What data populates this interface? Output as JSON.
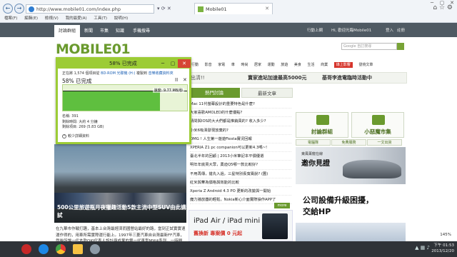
{
  "browser": {
    "url": "http://www.mobile01.com/index.php",
    "tab_title": "Mobile01",
    "back_glyph": "←",
    "forward_glyph": "→",
    "addr_tools": "▾ ⟳ ✕",
    "tab_close": "✕",
    "tools_glyphs": "⌂ ☆ ⚙",
    "window_controls": [
      "─",
      "▢",
      "✕"
    ],
    "command_bar": [
      "檔案(F)",
      "編輯(E)",
      "檢視(V)",
      "我的最愛(A)",
      "工具(T)",
      "說明(H)"
    ],
    "zoom": "145%"
  },
  "site": {
    "topnav": {
      "items": [
        "討論群組",
        "新聞",
        "市集",
        "知識",
        "手機搜尋"
      ],
      "right": [
        "行動上網",
        "Hi, 歡迎光臨Mobile01",
        "登入",
        "註冊"
      ]
    },
    "logo": "MOBILE01",
    "search_placeholder": "Google 自訂搜尋",
    "categories": [
      "行動",
      "影音",
      "家電",
      "車",
      "時尚",
      "居家",
      "運動",
      "旅遊",
      "美食",
      "生活",
      "商業",
      "綠上影響",
      "發燒文章"
    ],
    "banner": {
      "b1": "出清!!",
      "b2": "賣家進站加速最高5000元",
      "b3": "基哥李進電臨時活動中"
    },
    "list_tabs": [
      "熱門討論",
      "最新文章"
    ],
    "topics": [
      "Mac 11代螢幕設計的重要特色是什麼?",
      "大家喜歡AMOLED的什麼優點?",
      "請問與IOS的大大們都是推銷員的? 收入多少?",
      "小米6吸濕發現放棄的?",
      "OMG ! 人生第一遊遊Fiesta實況回報",
      "XPERIA Z1 pc companion可以更新4.3嗎~!",
      "臺北半年的回顧 | 2013小米筆記本平價優選",
      "明年年底買大眾，奧迪Q5哪一款比較好?",
      "不用再傳，搶先入過，三星特別長寬賣說? (圖)",
      "紅米與華為價格與效能的比較",
      "Xperia Z Android 4.3 PO 更新的改變與一開始",
      "魔力播放器的輕鬆，Nokia新心介面實際操作APP了"
    ],
    "more": "more",
    "hero_caption": "500公里旅遊瓶月夜獵趣活動5款主流中型SUV由此講試",
    "hero_text": "在九華市作戰打趣，基本上台灣最經濟而國營站最好的路，當到正試實實速運作得的，用車所需實際運行能上。1997年三菱汽車自台灣最新FF汽車，然後所讓一代本款OKI代表人設計與成果的第一代車型MW4系列，一時間都精速上汽車上Grand Weara頭Lead...",
    "rc_boxes": [
      "討論群組",
      "小惡魔市集"
    ],
    "rc_small": [
      "電腦隊",
      "免費服務",
      "一文出資"
    ],
    "ad_car": {
      "headline": "東風菁龍在線",
      "main": "邀你見證"
    },
    "ad_hp": {
      "line1": "公司設備升級困擾，",
      "line2": "交給HP"
    },
    "ad_ipad": {
      "line1": "iPad Air / iPad mini",
      "line2": "舊換新 專案價 0 元起"
    }
  },
  "dialog": {
    "title": "58% 已完成",
    "from_prefix": "正在將 1,574 個項目從 ",
    "from_link": "BD-ROM 光碟機 (H:)",
    "from_mid": " 複製到 ",
    "to_link": "音樂收藏資料夾",
    "percent_label": "58% 已完成",
    "pause": "II",
    "stop": "✕",
    "progress": 0.78,
    "speed": "速度: 9.77 MB/秒",
    "name": "名稱: 391",
    "time_left": "剩餘時間: 大約 4 分鐘",
    "items_left": "剩餘項目: 269 (5.83 GB)",
    "less": "較少詳細資料",
    "controls": [
      "─",
      "▢",
      "✕"
    ]
  },
  "taskbar": {
    "tray": "▲ ▦ ♪",
    "time": "下午 01:53",
    "date": "2013/12/20"
  },
  "colors": {
    "accent_green": "#6a9a2e",
    "dialog_green": "#9ccc35",
    "progress_fill": "#5fbf3f",
    "red": "#d6342b"
  }
}
